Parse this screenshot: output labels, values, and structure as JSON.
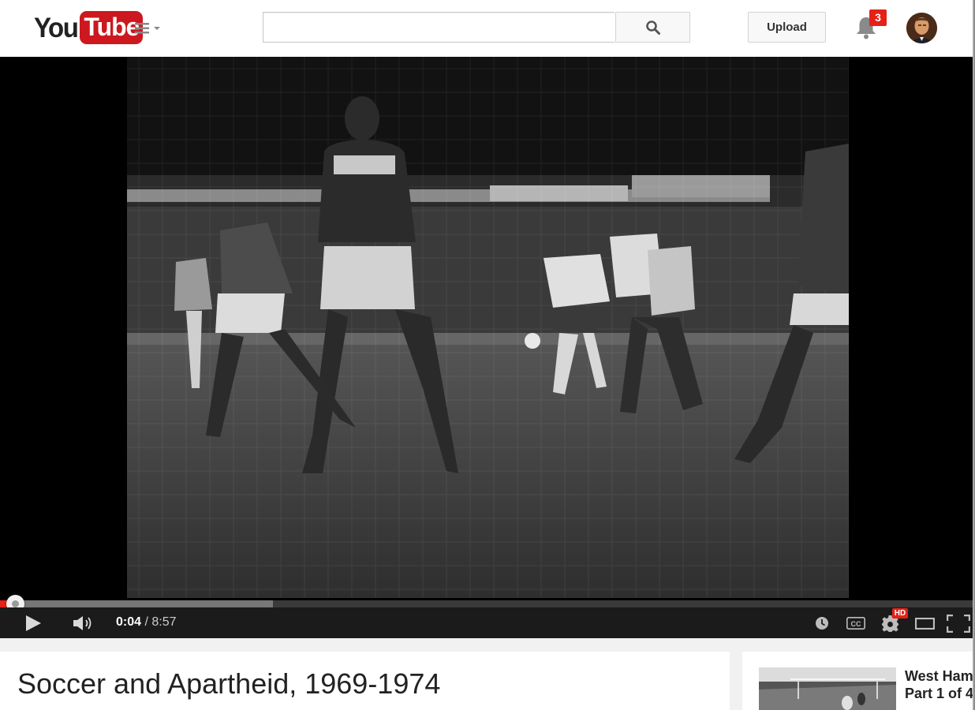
{
  "masthead": {
    "logo_you": "You",
    "logo_tube": "Tube",
    "search_placeholder": "",
    "search_value": "",
    "upload_label": "Upload",
    "notification_count": "3"
  },
  "icons": {
    "guide": "hamburger-menu-icon",
    "search": "magnifier-icon",
    "notifications": "bell-icon",
    "play": "play-icon",
    "volume": "speaker-icon",
    "watch_later": "clock-icon",
    "captions": "cc-icon",
    "settings": "gear-icon",
    "theater": "theater-mode-icon",
    "fullscreen": "fullscreen-icon"
  },
  "player": {
    "current_time": "0:04",
    "separator": " / ",
    "duration": "8:57",
    "played_fraction": 0.0074,
    "buffered_fraction": 0.2806,
    "quality_badge": "HD"
  },
  "video": {
    "title": "Soccer and Apartheid, 1969-1974"
  },
  "related": [
    {
      "title_line1": "West Ham",
      "title_line2": "Part 1 of 4"
    }
  ],
  "colors": {
    "brand_red": "#cc181e",
    "progress_red": "#e62117",
    "badge_red": "#e62117",
    "controls_bg": "#1b1b1b"
  }
}
